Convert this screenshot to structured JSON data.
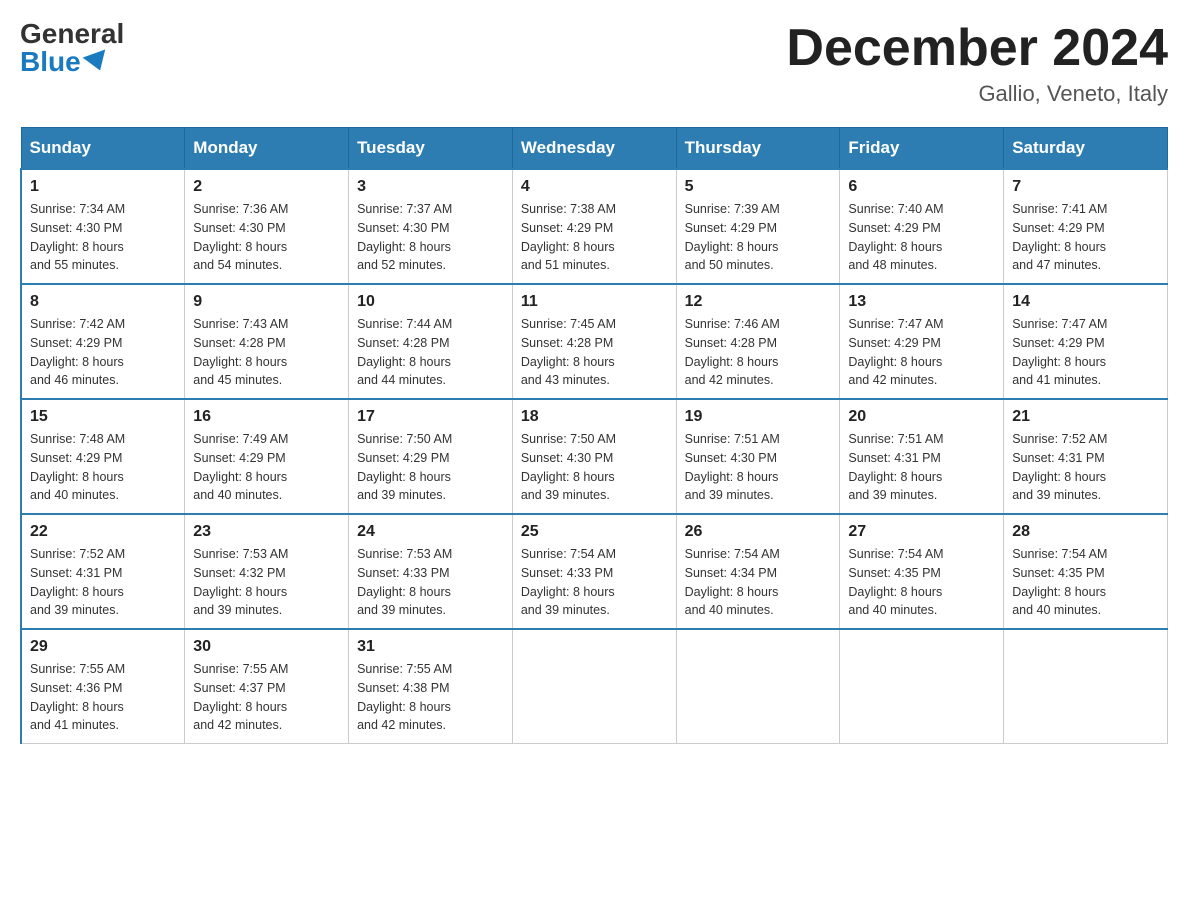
{
  "logo": {
    "general": "General",
    "blue": "Blue"
  },
  "title": "December 2024",
  "location": "Gallio, Veneto, Italy",
  "days_of_week": [
    "Sunday",
    "Monday",
    "Tuesday",
    "Wednesday",
    "Thursday",
    "Friday",
    "Saturday"
  ],
  "weeks": [
    [
      {
        "day": "1",
        "sunrise": "7:34 AM",
        "sunset": "4:30 PM",
        "daylight": "8 hours and 55 minutes."
      },
      {
        "day": "2",
        "sunrise": "7:36 AM",
        "sunset": "4:30 PM",
        "daylight": "8 hours and 54 minutes."
      },
      {
        "day": "3",
        "sunrise": "7:37 AM",
        "sunset": "4:30 PM",
        "daylight": "8 hours and 52 minutes."
      },
      {
        "day": "4",
        "sunrise": "7:38 AM",
        "sunset": "4:29 PM",
        "daylight": "8 hours and 51 minutes."
      },
      {
        "day": "5",
        "sunrise": "7:39 AM",
        "sunset": "4:29 PM",
        "daylight": "8 hours and 50 minutes."
      },
      {
        "day": "6",
        "sunrise": "7:40 AM",
        "sunset": "4:29 PM",
        "daylight": "8 hours and 48 minutes."
      },
      {
        "day": "7",
        "sunrise": "7:41 AM",
        "sunset": "4:29 PM",
        "daylight": "8 hours and 47 minutes."
      }
    ],
    [
      {
        "day": "8",
        "sunrise": "7:42 AM",
        "sunset": "4:29 PM",
        "daylight": "8 hours and 46 minutes."
      },
      {
        "day": "9",
        "sunrise": "7:43 AM",
        "sunset": "4:28 PM",
        "daylight": "8 hours and 45 minutes."
      },
      {
        "day": "10",
        "sunrise": "7:44 AM",
        "sunset": "4:28 PM",
        "daylight": "8 hours and 44 minutes."
      },
      {
        "day": "11",
        "sunrise": "7:45 AM",
        "sunset": "4:28 PM",
        "daylight": "8 hours and 43 minutes."
      },
      {
        "day": "12",
        "sunrise": "7:46 AM",
        "sunset": "4:28 PM",
        "daylight": "8 hours and 42 minutes."
      },
      {
        "day": "13",
        "sunrise": "7:47 AM",
        "sunset": "4:29 PM",
        "daylight": "8 hours and 42 minutes."
      },
      {
        "day": "14",
        "sunrise": "7:47 AM",
        "sunset": "4:29 PM",
        "daylight": "8 hours and 41 minutes."
      }
    ],
    [
      {
        "day": "15",
        "sunrise": "7:48 AM",
        "sunset": "4:29 PM",
        "daylight": "8 hours and 40 minutes."
      },
      {
        "day": "16",
        "sunrise": "7:49 AM",
        "sunset": "4:29 PM",
        "daylight": "8 hours and 40 minutes."
      },
      {
        "day": "17",
        "sunrise": "7:50 AM",
        "sunset": "4:29 PM",
        "daylight": "8 hours and 39 minutes."
      },
      {
        "day": "18",
        "sunrise": "7:50 AM",
        "sunset": "4:30 PM",
        "daylight": "8 hours and 39 minutes."
      },
      {
        "day": "19",
        "sunrise": "7:51 AM",
        "sunset": "4:30 PM",
        "daylight": "8 hours and 39 minutes."
      },
      {
        "day": "20",
        "sunrise": "7:51 AM",
        "sunset": "4:31 PM",
        "daylight": "8 hours and 39 minutes."
      },
      {
        "day": "21",
        "sunrise": "7:52 AM",
        "sunset": "4:31 PM",
        "daylight": "8 hours and 39 minutes."
      }
    ],
    [
      {
        "day": "22",
        "sunrise": "7:52 AM",
        "sunset": "4:31 PM",
        "daylight": "8 hours and 39 minutes."
      },
      {
        "day": "23",
        "sunrise": "7:53 AM",
        "sunset": "4:32 PM",
        "daylight": "8 hours and 39 minutes."
      },
      {
        "day": "24",
        "sunrise": "7:53 AM",
        "sunset": "4:33 PM",
        "daylight": "8 hours and 39 minutes."
      },
      {
        "day": "25",
        "sunrise": "7:54 AM",
        "sunset": "4:33 PM",
        "daylight": "8 hours and 39 minutes."
      },
      {
        "day": "26",
        "sunrise": "7:54 AM",
        "sunset": "4:34 PM",
        "daylight": "8 hours and 40 minutes."
      },
      {
        "day": "27",
        "sunrise": "7:54 AM",
        "sunset": "4:35 PM",
        "daylight": "8 hours and 40 minutes."
      },
      {
        "day": "28",
        "sunrise": "7:54 AM",
        "sunset": "4:35 PM",
        "daylight": "8 hours and 40 minutes."
      }
    ],
    [
      {
        "day": "29",
        "sunrise": "7:55 AM",
        "sunset": "4:36 PM",
        "daylight": "8 hours and 41 minutes."
      },
      {
        "day": "30",
        "sunrise": "7:55 AM",
        "sunset": "4:37 PM",
        "daylight": "8 hours and 42 minutes."
      },
      {
        "day": "31",
        "sunrise": "7:55 AM",
        "sunset": "4:38 PM",
        "daylight": "8 hours and 42 minutes."
      },
      null,
      null,
      null,
      null
    ]
  ],
  "labels": {
    "sunrise": "Sunrise:",
    "sunset": "Sunset:",
    "daylight": "Daylight:"
  }
}
